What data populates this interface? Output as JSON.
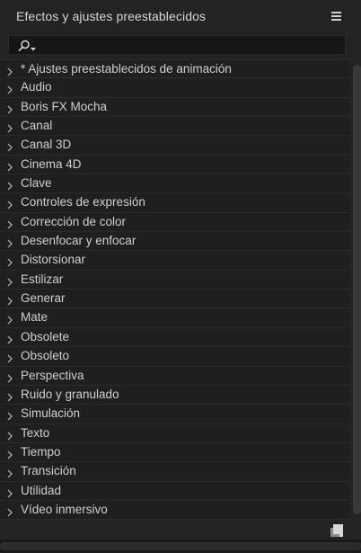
{
  "panel": {
    "title": "Efectos y ajustes preestablecidos",
    "menu_icon": "hamburger-menu-icon"
  },
  "search": {
    "value": "",
    "placeholder": "",
    "icon": "search-dropdown-icon"
  },
  "categories": [
    "* Ajustes preestablecidos de animación",
    "Audio",
    "Boris FX Mocha",
    "Canal",
    "Canal 3D",
    "Cinema 4D",
    "Clave",
    "Controles de expresión",
    "Corrección de color",
    "Desenfocar y enfocar",
    "Distorsionar",
    "Estilizar",
    "Generar",
    "Mate",
    "Obsolete",
    "Obsoleto",
    "Perspectiva",
    "Ruido y granulado",
    "Simulación",
    "Texto",
    "Tiempo",
    "Transición",
    "Utilidad",
    "Vídeo inmersivo"
  ],
  "footer": {
    "new_icon": "new-bin-icon"
  },
  "colors": {
    "panel_bg": "#232323",
    "list_bg": "#1f1f1f",
    "text": "#cfcfcf",
    "divider": "#2b2b2b"
  }
}
